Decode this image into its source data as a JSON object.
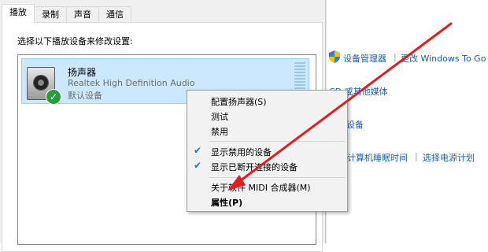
{
  "dialog": {
    "tabs": [
      {
        "label": "播放"
      },
      {
        "label": "录制"
      },
      {
        "label": "声音"
      },
      {
        "label": "通信"
      }
    ],
    "instruction": "选择以下播放设备来修改设置:",
    "device": {
      "name": "扬声器",
      "description": "Realtek High Definition Audio",
      "status": "默认设备"
    }
  },
  "context_menu": {
    "items": [
      {
        "label": "配置扬声器(S)",
        "checked": false
      },
      {
        "label": "测试",
        "checked": false
      },
      {
        "label": "禁用",
        "checked": false
      },
      {
        "label": "显示禁用的设备",
        "checked": true
      },
      {
        "label": "显示已断开连接的设备",
        "checked": true
      },
      {
        "label": "关于软件 MIDI 合成器(M)",
        "checked": false
      },
      {
        "label": "属性(P)",
        "checked": false,
        "bold": true
      }
    ]
  },
  "background": {
    "links": {
      "device_manager": "设备管理器",
      "windows_to_go": "更改 Windows To Go 启",
      "cd_media": "CD 或其他媒体",
      "devices": "设备",
      "sleep": "计算机睡眠时间",
      "power_plan": "选择电源计划"
    },
    "separator": "|"
  },
  "colors": {
    "selection": "#cce8ff",
    "link": "#1a5fb4",
    "arrow": "#e02020",
    "check": "#2a9d3a"
  }
}
